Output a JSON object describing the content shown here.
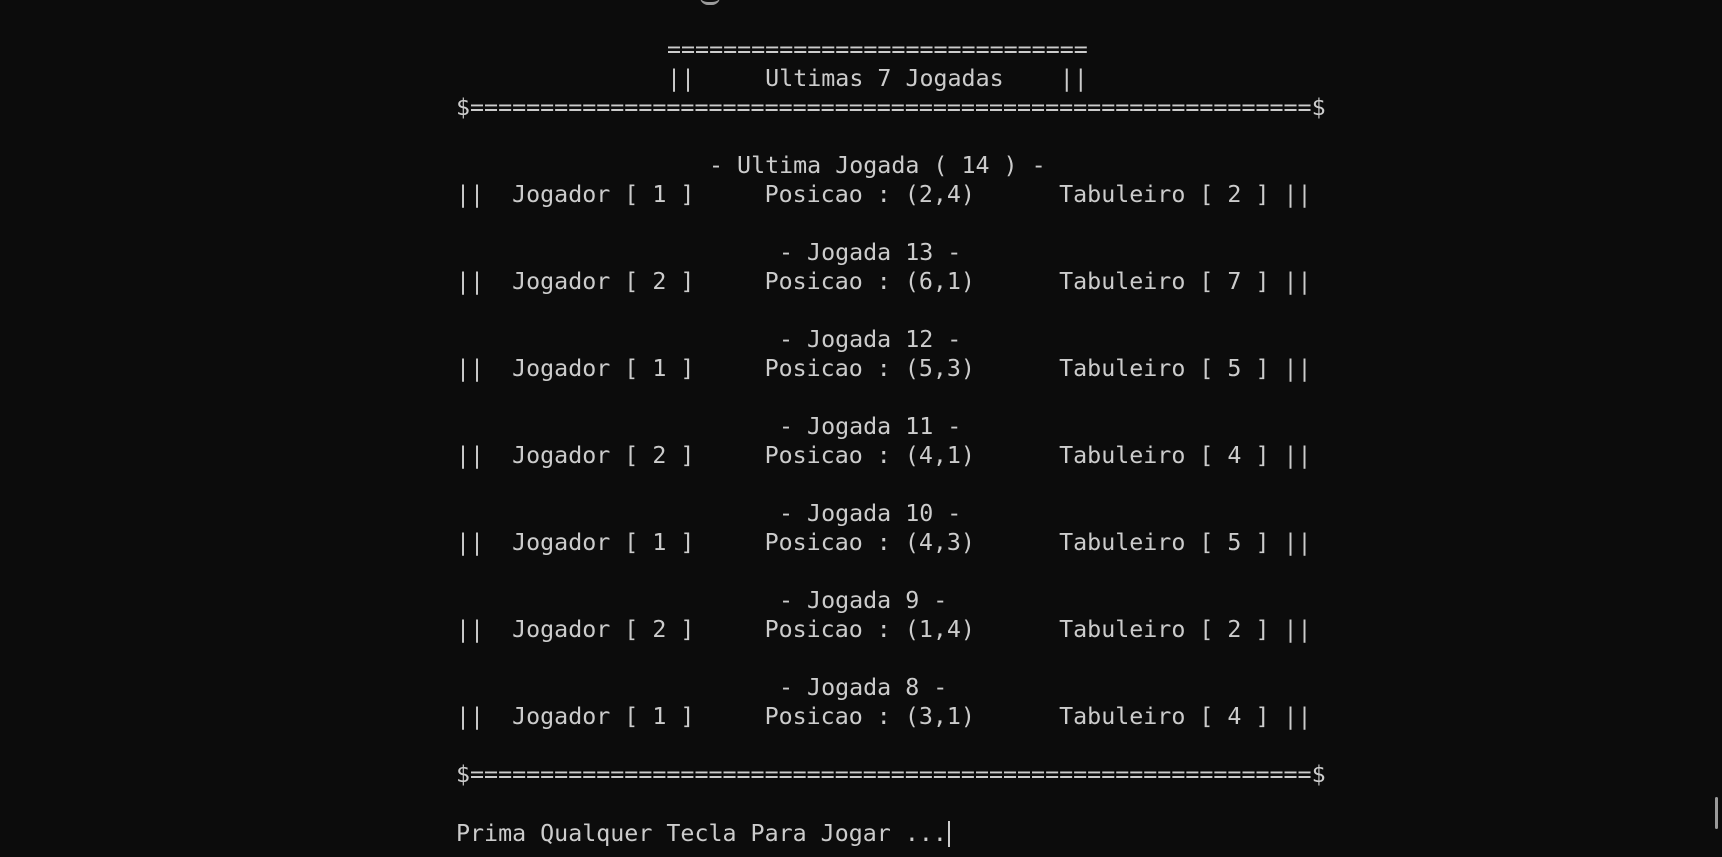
{
  "header": {
    "top_border": "==============================",
    "title_row": "||     Ultimas 7 Jogadas    ||",
    "frame_border": "$============================================================$"
  },
  "moves": [
    {
      "label": "- Ultima Jogada ( 14 ) -",
      "row": "||  Jogador [ 1 ]     Posicao : (2,4)      Tabuleiro [ 2 ] ||"
    },
    {
      "label": "- Jogada 13 -",
      "row": "||  Jogador [ 2 ]     Posicao : (6,1)      Tabuleiro [ 7 ] ||"
    },
    {
      "label": "- Jogada 12 -",
      "row": "||  Jogador [ 1 ]     Posicao : (5,3)      Tabuleiro [ 5 ] ||"
    },
    {
      "label": "- Jogada 11 -",
      "row": "||  Jogador [ 2 ]     Posicao : (4,1)      Tabuleiro [ 4 ] ||"
    },
    {
      "label": "- Jogada 10 -",
      "row": "||  Jogador [ 1 ]     Posicao : (4,3)      Tabuleiro [ 5 ] ||"
    },
    {
      "label": "- Jogada 9 -",
      "row": "||  Jogador [ 2 ]     Posicao : (1,4)      Tabuleiro [ 2 ] ||"
    },
    {
      "label": "- Jogada 8 -",
      "row": "||  Jogador [ 1 ]     Posicao : (3,1)      Tabuleiro [ 4 ] ||"
    }
  ],
  "footer": {
    "frame_border": "$============================================================$",
    "prompt": "Prima Qualquer Tecla Para Jogar ..."
  }
}
